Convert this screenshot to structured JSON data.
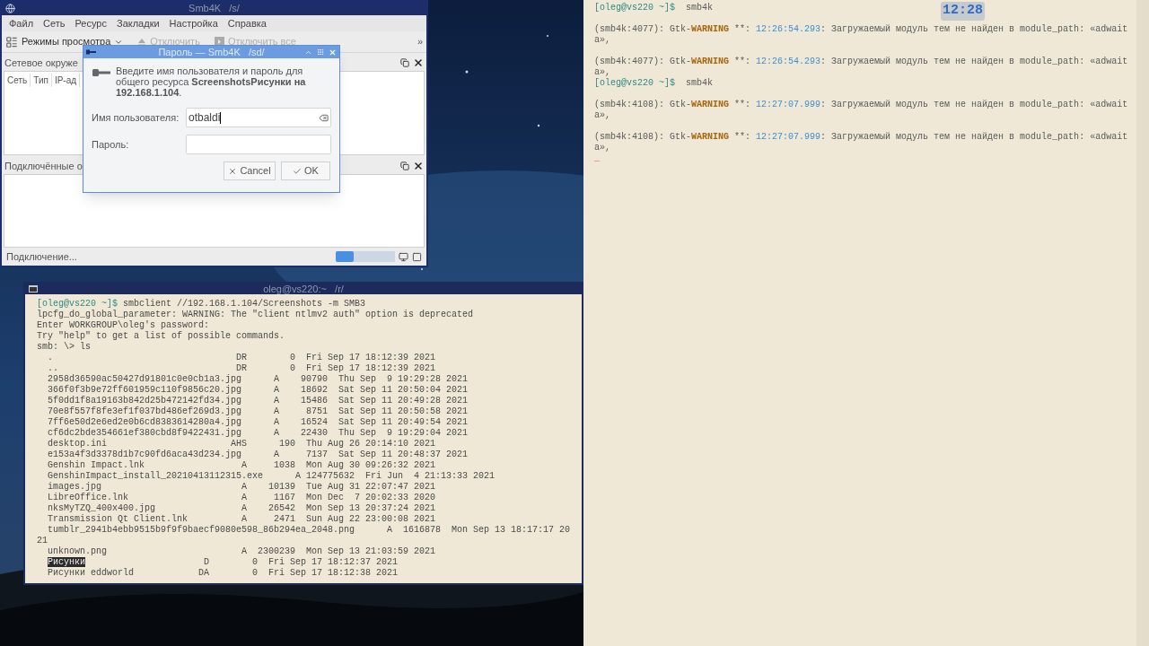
{
  "smb4k_window": {
    "title": "Smb4K   /s/",
    "menu": [
      "Файл",
      "Сеть",
      "Ресурс",
      "Закладки",
      "Настройка",
      "Справка"
    ],
    "toolbar": [
      {
        "label": "Режимы просмотра",
        "kind": "dropdown",
        "disabled": false
      },
      {
        "label": "Отключить",
        "kind": "eject",
        "disabled": true
      },
      {
        "label": "Отключить все",
        "kind": "unmount",
        "disabled": true
      }
    ],
    "overflow": "»",
    "network_panel": {
      "title": "Сетевое окруже",
      "columns": [
        "Сеть",
        "Тип",
        "IP-ад"
      ]
    },
    "mounted_panel": {
      "title": "Подключённые о"
    },
    "status_bar": {
      "text": "Подключение...",
      "level": 0.3
    }
  },
  "password_dialog": {
    "title": "Пароль — Smb4K   /sd/",
    "message": "Введите имя пользователя и пароль для общего ресурса **ScreenshotsРисунки на 192.168.1.104**.",
    "fields": [
      {
        "label": "Имя пользователя:",
        "value": "otbaldi",
        "kind": "text"
      },
      {
        "label": "Пароль:",
        "kind": "password"
      }
    ],
    "buttons": [
      {
        "label": "Cancel",
        "kind": "cancel"
      },
      {
        "label": "OK",
        "kind": "ok"
      }
    ]
  },
  "log_terminal": {
    "clock": "12:28",
    "lines": [
      {
        "kind": "text",
        "segments": [
          {
            "kind": "prompt",
            "text": "[oleg@vs220 ~]$"
          },
          {
            "kind": "plain",
            "text": "  smb4k"
          }
        ]
      },
      {
        "kind": "blank"
      },
      {
        "kind": "text",
        "segments": [
          {
            "kind": "plain",
            "text": "(smb4k:4077): Gtk-"
          },
          {
            "kind": "warning",
            "text": "WARNING"
          },
          {
            "kind": "plain",
            "text": " **: "
          },
          {
            "kind": "time",
            "text": "12:26:54.293"
          },
          {
            "kind": "plain",
            "text": ": Загружаемый модуль тем не найден в module_path: «adwait"
          }
        ]
      },
      {
        "kind": "text",
        "segments": [
          {
            "kind": "plain",
            "text": "a»,"
          }
        ]
      },
      {
        "kind": "blank"
      },
      {
        "kind": "text",
        "segments": [
          {
            "kind": "plain",
            "text": "(smb4k:4077): Gtk-"
          },
          {
            "kind": "warning",
            "text": "WARNING"
          },
          {
            "kind": "plain",
            "text": " **: "
          },
          {
            "kind": "time",
            "text": "12:26:54.293"
          },
          {
            "kind": "plain",
            "text": ": Загружаемый модуль тем не найден в module_path: «adwait"
          }
        ]
      },
      {
        "kind": "text",
        "segments": [
          {
            "kind": "plain",
            "text": "a»,"
          }
        ]
      },
      {
        "kind": "text",
        "segments": [
          {
            "kind": "prompt",
            "text": "[oleg@vs220 ~]$"
          },
          {
            "kind": "plain",
            "text": "  smb4k"
          }
        ]
      },
      {
        "kind": "blank"
      },
      {
        "kind": "text",
        "segments": [
          {
            "kind": "plain",
            "text": "(smb4k:4108): Gtk-"
          },
          {
            "kind": "warning",
            "text": "WARNING"
          },
          {
            "kind": "plain",
            "text": " **: "
          },
          {
            "kind": "time",
            "text": "12:27:07.999"
          },
          {
            "kind": "plain",
            "text": ": Загружаемый модуль тем не найден в module_path: «adwait"
          }
        ]
      },
      {
        "kind": "text",
        "segments": [
          {
            "kind": "plain",
            "text": "a»,"
          }
        ]
      },
      {
        "kind": "blank"
      },
      {
        "kind": "text",
        "segments": [
          {
            "kind": "plain",
            "text": "(smb4k:4108): Gtk-"
          },
          {
            "kind": "warning",
            "text": "WARNING"
          },
          {
            "kind": "plain",
            "text": " **: "
          },
          {
            "kind": "time",
            "text": "12:27:07.999"
          },
          {
            "kind": "plain",
            "text": ": Загружаемый модуль тем не найден в module_path: «adwait"
          }
        ]
      },
      {
        "kind": "text",
        "segments": [
          {
            "kind": "plain",
            "text": "a»,"
          }
        ]
      },
      {
        "kind": "cursor",
        "segments": [
          {
            "kind": "cursor",
            "text": "_"
          }
        ]
      }
    ]
  },
  "smbclient_terminal": {
    "title": "oleg@vs220:~   /r/",
    "lines": [
      {
        "kind": "text",
        "segments": [
          {
            "kind": "prompt",
            "text": "[oleg@vs220 ~]$"
          },
          {
            "kind": "plain",
            "text": " smbclient //192.168.1.104/Screenshots -m SMB3"
          }
        ]
      },
      {
        "kind": "text",
        "segments": [
          {
            "kind": "plain",
            "text": "lpcfg_do_global_parameter: WARNING: The \"client ntlmv2 auth\" option is deprecated"
          }
        ]
      },
      {
        "kind": "text",
        "segments": [
          {
            "kind": "plain",
            "text": "Enter WORKGROUP\\oleg's password:"
          }
        ]
      },
      {
        "kind": "text",
        "segments": [
          {
            "kind": "plain",
            "text": "Try \"help\" to get a list of possible commands."
          }
        ]
      },
      {
        "kind": "text",
        "segments": [
          {
            "kind": "plain",
            "text": "smb: \\> ls"
          }
        ]
      },
      {
        "kind": "text",
        "segments": [
          {
            "kind": "plain",
            "text": "  .                                  DR        0  Fri Sep 17 18:12:39 2021"
          }
        ]
      },
      {
        "kind": "text",
        "segments": [
          {
            "kind": "plain",
            "text": "  ..                                 DR        0  Fri Sep 17 18:12:39 2021"
          }
        ]
      },
      {
        "kind": "text",
        "segments": [
          {
            "kind": "plain",
            "text": "  2958d36590ac50427d91801c0e0cb1a3.jpg      A    90790  Thu Sep  9 19:29:28 2021"
          }
        ]
      },
      {
        "kind": "text",
        "segments": [
          {
            "kind": "plain",
            "text": "  366f0f3b9e72ff601959c110f9856c20.jpg      A    18692  Sat Sep 11 20:50:04 2021"
          }
        ]
      },
      {
        "kind": "text",
        "segments": [
          {
            "kind": "plain",
            "text": "  5f0dd1f8a19163b842d25b472142fd34.jpg      A    15486  Sat Sep 11 20:49:28 2021"
          }
        ]
      },
      {
        "kind": "text",
        "segments": [
          {
            "kind": "plain",
            "text": "  70e8f557f8fe3ef1f037bd486ef269d3.jpg      A     8751  Sat Sep 11 20:50:58 2021"
          }
        ]
      },
      {
        "kind": "text",
        "segments": [
          {
            "kind": "plain",
            "text": "  7ff6e50d2e6ed2e0b6cd8383614280a4.jpg      A    16524  Sat Sep 11 20:49:54 2021"
          }
        ]
      },
      {
        "kind": "text",
        "segments": [
          {
            "kind": "plain",
            "text": "  cf6dc2bde354661ef380cbd8f9422431.jpg      A    22430  Thu Sep  9 19:29:04 2021"
          }
        ]
      },
      {
        "kind": "text",
        "segments": [
          {
            "kind": "plain",
            "text": "  desktop.ini                       AHS      190  Thu Aug 26 20:14:10 2021"
          }
        ]
      },
      {
        "kind": "text",
        "segments": [
          {
            "kind": "plain",
            "text": "  e153a4f3d3378d1b7c90fd6aca43d234.jpg      A     7137  Sat Sep 11 20:48:37 2021"
          }
        ]
      },
      {
        "kind": "text",
        "segments": [
          {
            "kind": "plain",
            "text": "  Genshin Impact.lnk                  A     1038  Mon Aug 30 09:26:32 2021"
          }
        ]
      },
      {
        "kind": "text",
        "segments": [
          {
            "kind": "plain",
            "text": "  GenshinImpact_install_20210413112315.exe      A 124775632  Fri Jun  4 21:13:33 2021"
          }
        ]
      },
      {
        "kind": "text",
        "segments": [
          {
            "kind": "plain",
            "text": "  images.jpg                          A    10139  Tue Aug 31 22:07:47 2021"
          }
        ]
      },
      {
        "kind": "text",
        "segments": [
          {
            "kind": "plain",
            "text": "  LibreOffice.lnk                     A     1167  Mon Dec  7 20:02:33 2020"
          }
        ]
      },
      {
        "kind": "text",
        "segments": [
          {
            "kind": "plain",
            "text": "  nksMyTZQ_400x400.jpg                A    26542  Mon Sep 13 20:37:24 2021"
          }
        ]
      },
      {
        "kind": "text",
        "segments": [
          {
            "kind": "plain",
            "text": "  Transmission Qt Client.lnk          A     2471  Sun Aug 22 23:00:08 2021"
          }
        ]
      },
      {
        "kind": "text",
        "segments": [
          {
            "kind": "plain",
            "text": "  tumblr_2941b4ebb9515b9f9f9baecf9080e598_86b294ea_2048.png      A  1616878  Mon Sep 13 18:17:17 20"
          }
        ]
      },
      {
        "kind": "text",
        "segments": [
          {
            "kind": "plain",
            "text": "21"
          }
        ]
      },
      {
        "kind": "text",
        "segments": [
          {
            "kind": "plain",
            "text": "  unknown.png                         A  2300239  Mon Sep 13 21:03:59 2021"
          }
        ]
      },
      {
        "kind": "text",
        "segments": [
          {
            "kind": "indent"
          },
          {
            "kind": "selection",
            "text": "Рисунки"
          },
          {
            "kind": "plain",
            "text": "                      D        0  Fri Sep 17 18:12:37 2021"
          }
        ]
      },
      {
        "kind": "text",
        "segments": [
          {
            "kind": "plain",
            "text": "  Рисунки eddworld            DA        0  Fri Sep 17 18:12:38 2021"
          }
        ]
      }
    ]
  }
}
